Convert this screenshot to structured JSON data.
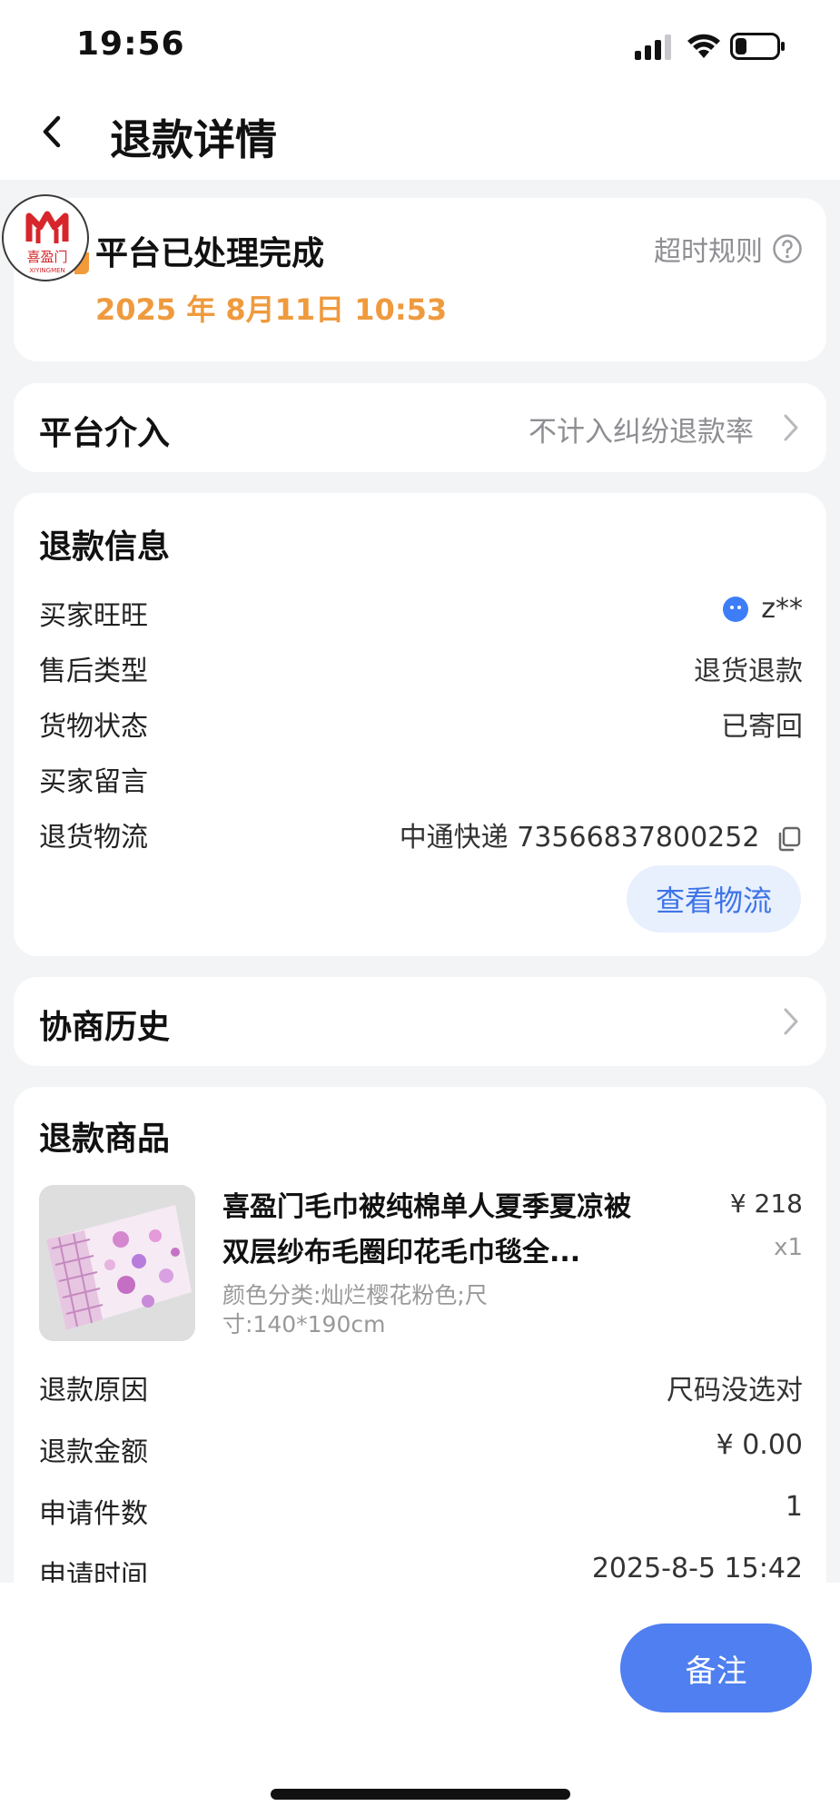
{
  "status_bar": {
    "time": "19:56"
  },
  "nav": {
    "title": "退款详情"
  },
  "refund_status": {
    "logo_text": "喜盈门",
    "logo_sub": "XIYINGMEN",
    "title": "平台已处理完成",
    "date": "2025 年 8月11日 10:53",
    "rule_link": "超时规则",
    "accent_color": "#ef9a3e"
  },
  "platform": {
    "label": "平台介入",
    "value": "不计入纠纷退款率"
  },
  "refund_info": {
    "title": "退款信息",
    "rows": [
      {
        "label": "买家旺旺",
        "value": "z**"
      },
      {
        "label": "售后类型",
        "value": "退货退款"
      },
      {
        "label": "货物状态",
        "value": "已寄回"
      },
      {
        "label": "买家留言",
        "value": ""
      },
      {
        "label": "退货物流",
        "value": "中通快递 73566837800252"
      }
    ],
    "logistics_button": "查看物流"
  },
  "history": {
    "label": "协商历史"
  },
  "refund_goods": {
    "title": "退款商品",
    "product": {
      "title": "喜盈门毛巾被纯棉单人夏季夏凉被双层纱布毛圈印花毛巾毯全...",
      "sku": "颜色分类:灿烂樱花粉色;尺寸:140*190cm",
      "price": "¥ 218",
      "qty": "x1"
    },
    "rows": [
      {
        "label": "退款原因",
        "value": "尺码没选对"
      },
      {
        "label": "退款金额",
        "value": "¥ 0.00"
      },
      {
        "label": "申请件数",
        "value": "1"
      },
      {
        "label": "申请时间",
        "value": "2025-8-5 15:42"
      }
    ]
  },
  "bottom": {
    "remark_button": "备注",
    "button_color": "#4f7ff0"
  }
}
